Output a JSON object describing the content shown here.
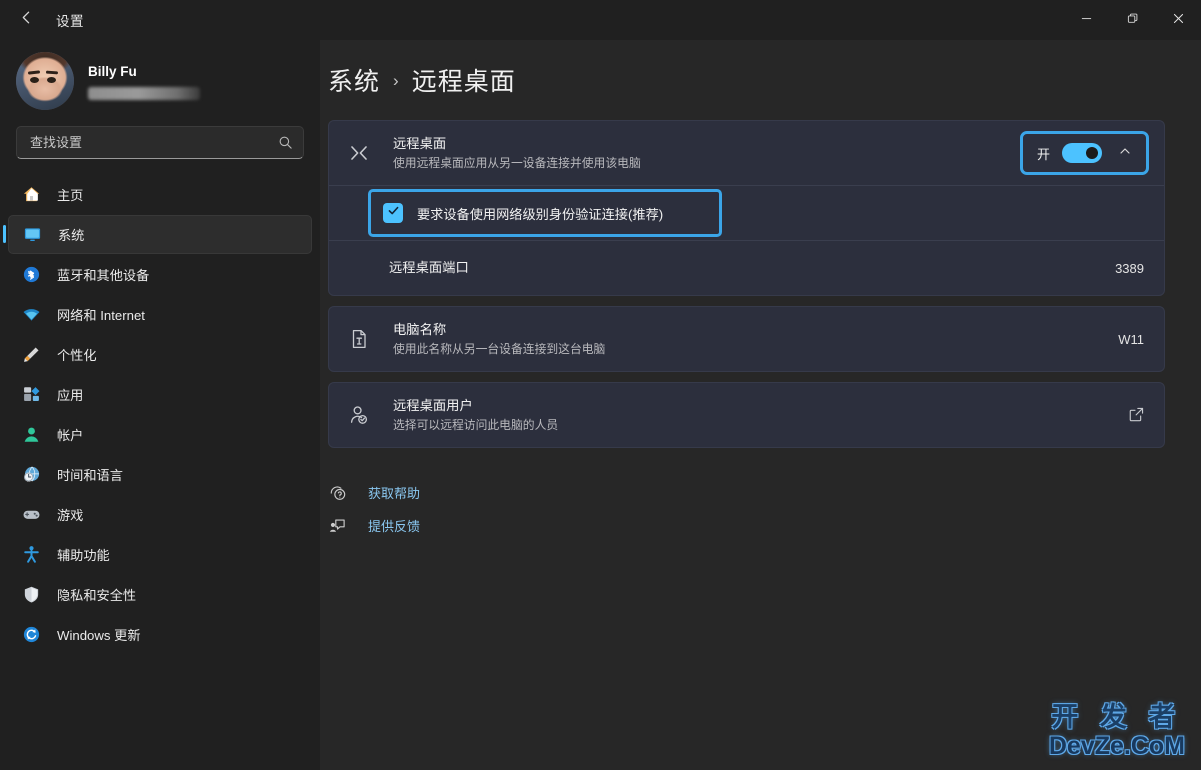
{
  "window": {
    "title": "设置",
    "back_icon": "back-arrow-icon",
    "minimize_label": "最小化",
    "maximize_label": "最大化",
    "close_label": "关闭"
  },
  "sidebar": {
    "profile": {
      "name": "Billy Fu",
      "email_masked": ""
    },
    "search": {
      "placeholder": "查找设置",
      "value": ""
    },
    "items": [
      {
        "label": "主页",
        "icon": "home-icon",
        "active": false
      },
      {
        "label": "系统",
        "icon": "system-display-icon",
        "active": true
      },
      {
        "label": "蓝牙和其他设备",
        "icon": "bluetooth-icon",
        "active": false
      },
      {
        "label": "网络和 Internet",
        "icon": "wifi-icon",
        "active": false
      },
      {
        "label": "个性化",
        "icon": "paintbrush-icon",
        "active": false
      },
      {
        "label": "应用",
        "icon": "apps-icon",
        "active": false
      },
      {
        "label": "帐户",
        "icon": "account-icon",
        "active": false
      },
      {
        "label": "时间和语言",
        "icon": "clock-globe-icon",
        "active": false
      },
      {
        "label": "游戏",
        "icon": "gamepad-icon",
        "active": false
      },
      {
        "label": "辅助功能",
        "icon": "accessibility-icon",
        "active": false
      },
      {
        "label": "隐私和安全性",
        "icon": "shield-icon",
        "active": false
      },
      {
        "label": "Windows 更新",
        "icon": "update-refresh-icon",
        "active": false
      }
    ]
  },
  "breadcrumb": {
    "parent": "系统",
    "separator": "›",
    "current": "远程桌面"
  },
  "main": {
    "remote_desktop": {
      "icon": "remote-desktop-icon",
      "title": "远程桌面",
      "subtitle": "使用远程桌面应用从另一设备连接并使用该电脑",
      "toggle_state_label": "开",
      "toggle_on": true,
      "expand_icon": "chevron-up-icon",
      "highlighted": true
    },
    "nla": {
      "label": "要求设备使用网络级别身份验证连接(推荐)",
      "checked": true,
      "check_icon": "checkmark-icon",
      "highlighted": true
    },
    "port": {
      "title": "远程桌面端口",
      "value": "3389"
    },
    "pc_name": {
      "icon": "rename-document-icon",
      "title": "电脑名称",
      "subtitle": "使用此名称从另一台设备连接到这台电脑",
      "value": "W11"
    },
    "rd_users": {
      "icon": "user-check-icon",
      "title": "远程桌面用户",
      "subtitle": "选择可以远程访问此电脑的人员",
      "action_icon": "open-external-icon"
    },
    "links": [
      {
        "label": "获取帮助",
        "icon": "help-icon"
      },
      {
        "label": "提供反馈",
        "icon": "feedback-icon"
      }
    ]
  },
  "watermark": {
    "line1": "开 发 者",
    "line2": "DevZe.CoM"
  },
  "colors": {
    "accent": "#4cc2ff",
    "highlight_outline": "#3ba5e8",
    "card_bg": "#2c2f3d",
    "main_bg": "#272727",
    "sidebar_bg": "#202020",
    "link_text": "#8ac7f0"
  }
}
